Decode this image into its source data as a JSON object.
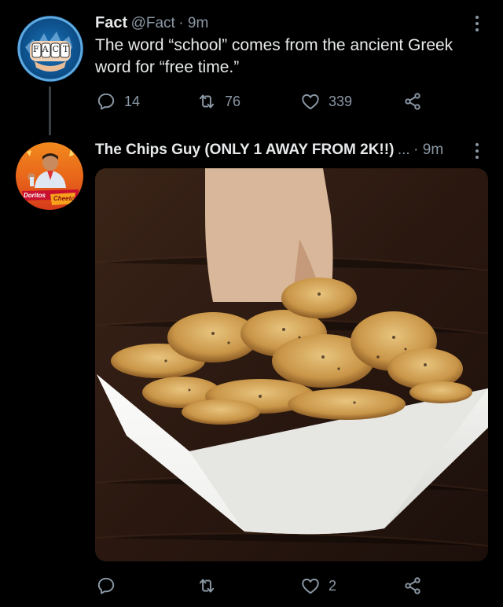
{
  "tweet1": {
    "display_name": "Fact",
    "handle": "@Fact",
    "time": "· 9m",
    "text_line1": "The word “school” comes from the ancient Greek",
    "text_line2": "word for “free time.”",
    "avatar_label": "FACT",
    "actions": {
      "replies": "14",
      "retweets": "76",
      "likes": "339"
    }
  },
  "tweet2": {
    "display_name": "The Chips Guy (ONLY 1 AWAY FROM 2K!!)",
    "ellipsis": "...",
    "time": "· 9m",
    "avatar_brand1": "Doritos",
    "avatar_brand2": "Cheetos",
    "actions": {
      "replies": "",
      "retweets": "",
      "likes": "2"
    }
  },
  "icons": [
    "reply-icon",
    "retweet-icon",
    "like-icon",
    "share-icon",
    "more-icon"
  ],
  "colors": {
    "background": "#000000",
    "text": "#e7e9ea",
    "muted": "#8b98a5"
  }
}
